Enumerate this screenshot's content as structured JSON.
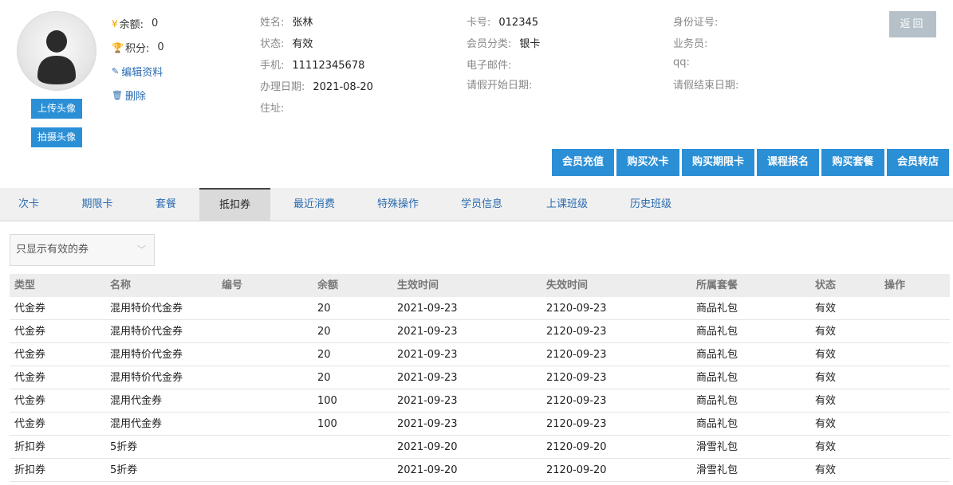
{
  "profile": {
    "upload_avatar": "上传头像",
    "take_photo": "拍摄头像",
    "balance_label": "余额:",
    "balance_value": "0",
    "points_label": "积分:",
    "points_value": "0",
    "edit_label": "编辑资料",
    "delete_label": "删除",
    "currency_symbol": "¥"
  },
  "info": {
    "name_label": "姓名:",
    "name_value": "张林",
    "status_label": "状态:",
    "status_value": "有效",
    "phone_label": "手机:",
    "phone_value": "11112345678",
    "date_label": "办理日期:",
    "date_value": "2021-08-20",
    "address_label": "住址:",
    "card_label": "卡号:",
    "card_value": "012345",
    "category_label": "会员分类:",
    "category_value": "银卡",
    "email_label": "电子邮件:",
    "leave_start_label": "请假开始日期:",
    "id_label": "身份证号:",
    "sales_label": "业务员:",
    "qq_label": "qq:",
    "leave_end_label": "请假结束日期:"
  },
  "back_label": "返回",
  "actions": [
    "会员充值",
    "购买次卡",
    "购买期限卡",
    "课程报名",
    "购买套餐",
    "会员转店"
  ],
  "tabs": [
    "次卡",
    "期限卡",
    "套餐",
    "抵扣券",
    "最近消费",
    "特殊操作",
    "学员信息",
    "上课班级",
    "历史班级"
  ],
  "active_tab": "抵扣券",
  "filter": {
    "selected": "只显示有效的券"
  },
  "table": {
    "headers": [
      "类型",
      "名称",
      "编号",
      "余额",
      "生效时间",
      "失效时间",
      "所属套餐",
      "状态",
      "操作"
    ],
    "rows": [
      [
        "代金券",
        "混用特价代金券",
        "",
        "20",
        "2021-09-23",
        "2120-09-23",
        "商品礼包",
        "有效",
        ""
      ],
      [
        "代金券",
        "混用特价代金券",
        "",
        "20",
        "2021-09-23",
        "2120-09-23",
        "商品礼包",
        "有效",
        ""
      ],
      [
        "代金券",
        "混用特价代金券",
        "",
        "20",
        "2021-09-23",
        "2120-09-23",
        "商品礼包",
        "有效",
        ""
      ],
      [
        "代金券",
        "混用特价代金券",
        "",
        "20",
        "2021-09-23",
        "2120-09-23",
        "商品礼包",
        "有效",
        ""
      ],
      [
        "代金券",
        "混用代金券",
        "",
        "100",
        "2021-09-23",
        "2120-09-23",
        "商品礼包",
        "有效",
        ""
      ],
      [
        "代金券",
        "混用代金券",
        "",
        "100",
        "2021-09-23",
        "2120-09-23",
        "商品礼包",
        "有效",
        ""
      ],
      [
        "折扣券",
        "5折券",
        "",
        "",
        "2021-09-20",
        "2120-09-20",
        "滑雪礼包",
        "有效",
        ""
      ],
      [
        "折扣券",
        "5折券",
        "",
        "",
        "2021-09-20",
        "2120-09-20",
        "滑雪礼包",
        "有效",
        ""
      ]
    ]
  }
}
